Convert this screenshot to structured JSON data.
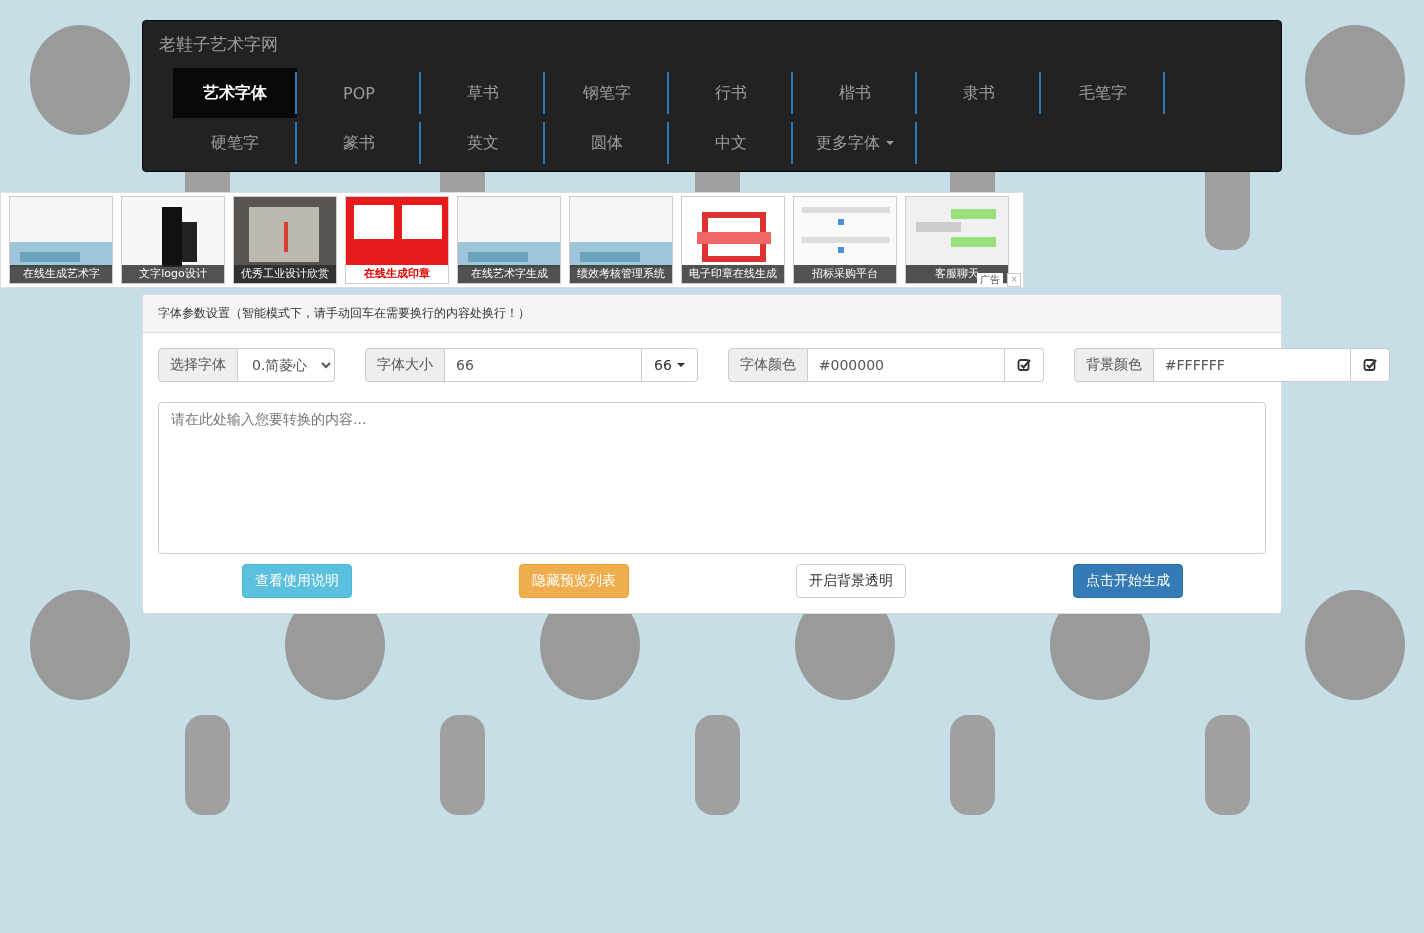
{
  "navbar": {
    "brand": "老鞋子艺术字网",
    "items": [
      {
        "label": "艺术字体",
        "selected": true,
        "kind": "link"
      },
      {
        "label": "POP",
        "selected": false,
        "kind": "link"
      },
      {
        "label": "草书",
        "selected": false,
        "kind": "link"
      },
      {
        "label": "钢笔字",
        "selected": false,
        "kind": "link"
      },
      {
        "label": "行书",
        "selected": false,
        "kind": "link"
      },
      {
        "label": "楷书",
        "selected": false,
        "kind": "link"
      },
      {
        "label": "隶书",
        "selected": false,
        "kind": "link"
      },
      {
        "label": "毛笔字",
        "selected": false,
        "kind": "link"
      },
      {
        "label": "硬笔字",
        "selected": false,
        "kind": "link"
      },
      {
        "label": "篆书",
        "selected": false,
        "kind": "link"
      },
      {
        "label": "英文",
        "selected": false,
        "kind": "link"
      },
      {
        "label": "圆体",
        "selected": false,
        "kind": "link"
      },
      {
        "label": "中文",
        "selected": false,
        "kind": "link"
      },
      {
        "label": "更多字体",
        "selected": false,
        "kind": "dropdown"
      }
    ]
  },
  "ads": {
    "badge": "广告",
    "close": "×",
    "items": [
      {
        "kind": "picture",
        "caption": "在线生成艺术字"
      },
      {
        "kind": "picture",
        "caption": "文字logo设计"
      },
      {
        "kind": "picture",
        "caption": "优秀工业设计欣赏"
      },
      {
        "kind": "picture",
        "caption": "在线生成印章",
        "color": "#e00000"
      },
      {
        "kind": "picture",
        "caption": "在线艺术字生成"
      },
      {
        "kind": "picture",
        "caption": "绩效考核管理系统"
      },
      {
        "kind": "picture",
        "caption": "电子印章在线生成"
      },
      {
        "kind": "picture",
        "caption": "招标采购平台"
      },
      {
        "kind": "picture",
        "caption": "客服聊天"
      }
    ]
  },
  "panel": {
    "heading": "字体参数设置（智能模式下，请手动回车在需要换行的内容处换行！）",
    "fields": [
      {
        "kind": "select",
        "label": "选择字体",
        "value": "0.简菱心"
      },
      {
        "kind": "size",
        "label": "字体大小",
        "value": "66",
        "button": "66"
      },
      {
        "kind": "color",
        "label": "字体颜色",
        "value": "#000000"
      },
      {
        "kind": "color",
        "label": "背景颜色",
        "value": "#FFFFFF"
      }
    ],
    "textarea": {
      "placeholder": "请在此处输入您要转换的内容..."
    },
    "buttons": [
      {
        "label": "查看使用说明",
        "kind": "info"
      },
      {
        "label": "隐藏预览列表",
        "kind": "warning"
      },
      {
        "label": "开启背景透明",
        "kind": "default"
      },
      {
        "label": "点击开始生成",
        "kind": "primary"
      }
    ]
  }
}
